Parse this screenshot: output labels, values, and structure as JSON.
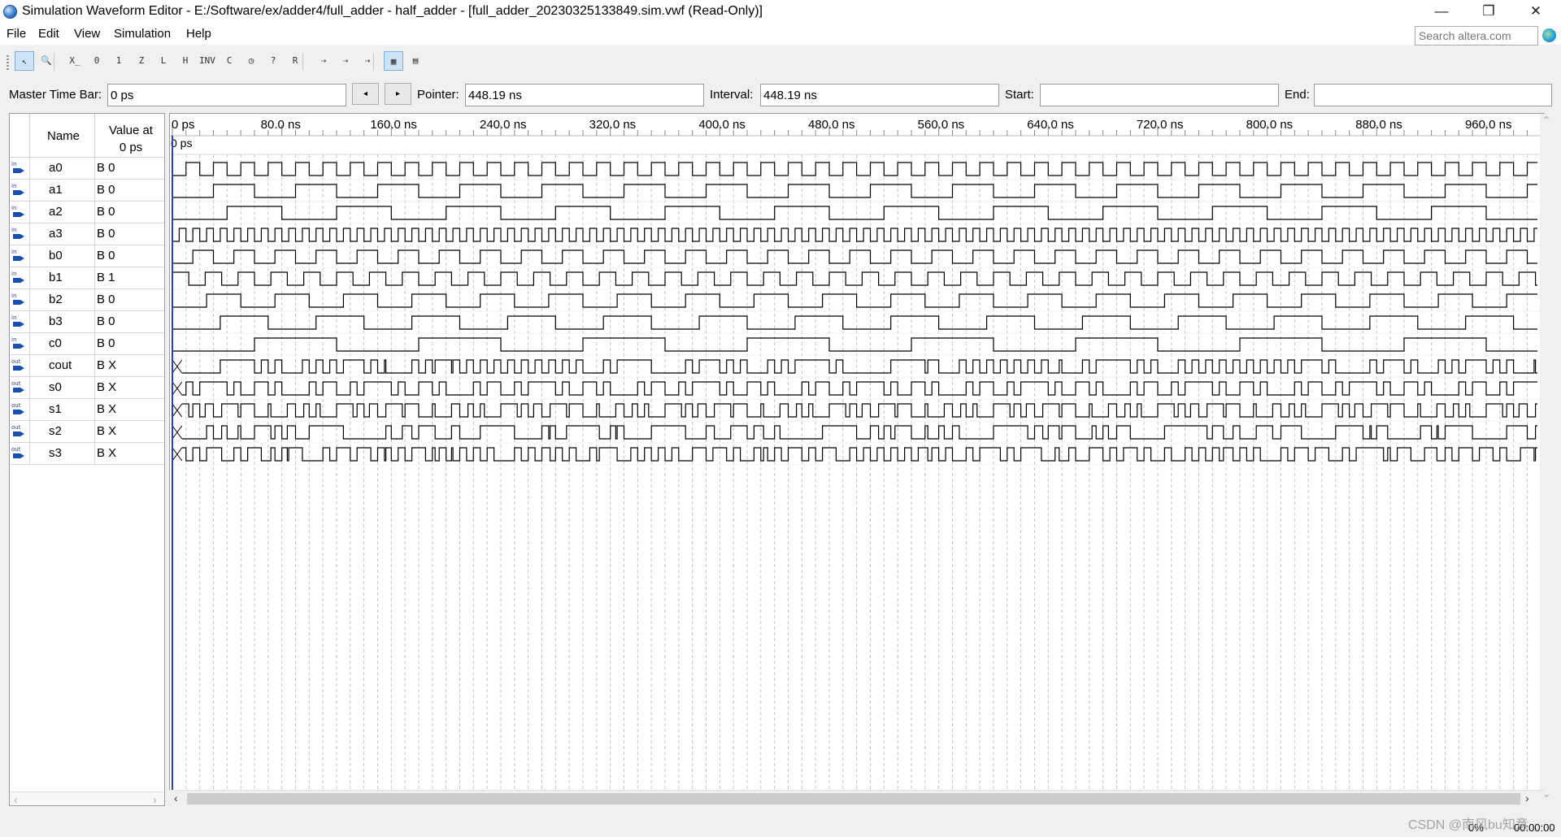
{
  "window": {
    "title": "Simulation Waveform Editor - E:/Software/ex/adder4/full_adder - half_adder - [full_adder_20230325133849.sim.vwf (Read-Only)]",
    "minimize": "—",
    "restore": "❐",
    "close": "✕"
  },
  "menu": {
    "items": [
      {
        "label": "File",
        "hotkey": "F"
      },
      {
        "label": "Edit",
        "hotkey": "E"
      },
      {
        "label": "View",
        "hotkey": "V"
      },
      {
        "label": "Simulation",
        "hotkey": "S"
      },
      {
        "label": "Help",
        "hotkey": "H"
      }
    ]
  },
  "search": {
    "placeholder": "Search altera.com"
  },
  "toolbar": {
    "buttons": [
      {
        "name": "selection-tool-icon",
        "glyph": "↖",
        "active": true
      },
      {
        "name": "zoom-tool-icon",
        "glyph": "🔍"
      },
      {
        "name": "force-unknown-icon",
        "glyph": "X̲"
      },
      {
        "name": "force-low-icon",
        "glyph": "0"
      },
      {
        "name": "force-high-icon",
        "glyph": "1"
      },
      {
        "name": "force-high-impedance-icon",
        "glyph": "Z"
      },
      {
        "name": "force-weak-low-icon",
        "glyph": "L"
      },
      {
        "name": "force-weak-high-icon",
        "glyph": "H"
      },
      {
        "name": "invert-icon",
        "glyph": "INV"
      },
      {
        "name": "count-value-icon",
        "glyph": "C"
      },
      {
        "name": "overwrite-clock-icon",
        "glyph": "◷"
      },
      {
        "name": "arbitrary-value-icon",
        "glyph": "?"
      },
      {
        "name": "random-values-icon",
        "glyph": "R"
      },
      {
        "name": "run-functional-icon",
        "glyph": "⇢"
      },
      {
        "name": "run-timing-icon",
        "glyph": "⇢"
      },
      {
        "name": "generate-netlist-icon",
        "glyph": "⇢"
      },
      {
        "name": "snap-to-grid-icon",
        "glyph": "▦",
        "active": true
      },
      {
        "name": "sort-icon",
        "glyph": "▤"
      }
    ]
  },
  "timebar": {
    "master_label": "Master Time Bar:",
    "master_value": "0 ps",
    "prev": "◂",
    "next": "▸",
    "pointer_label": "Pointer:",
    "pointer_value": "448.19 ns",
    "interval_label": "Interval:",
    "interval_value": "448.19 ns",
    "start_label": "Start:",
    "start_value": "",
    "end_label": "End:",
    "end_value": ""
  },
  "names_pane": {
    "col_name": "Name",
    "col_value_line1": "Value at",
    "col_value_line2": "0 ps"
  },
  "ruler": {
    "ticks": [
      "0 ps",
      "80.0 ns",
      "160.0 ns",
      "240.0 ns",
      "320.0 ns",
      "400.0 ns",
      "480.0 ns",
      "560.0 ns",
      "640.0 ns",
      "720.0 ns",
      "800.0 ns",
      "880.0 ns",
      "960.0 ns"
    ],
    "marker": "0 ps"
  },
  "signals": [
    {
      "name": "a0",
      "dir": "in",
      "value": "B 0",
      "half_period_ns": 10,
      "init": 0,
      "unknown_ns": 0
    },
    {
      "name": "a1",
      "dir": "in",
      "value": "B 0",
      "half_period_ns": 30,
      "init": 0,
      "unknown_ns": 0
    },
    {
      "name": "a2",
      "dir": "in",
      "value": "B 0",
      "half_period_ns": 40,
      "init": 0,
      "unknown_ns": 0
    },
    {
      "name": "a3",
      "dir": "in",
      "value": "B 0",
      "half_period_ns": 5,
      "init": 0,
      "unknown_ns": 0
    },
    {
      "name": "b0",
      "dir": "in",
      "value": "B 0",
      "half_period_ns": 15,
      "init": 0,
      "unknown_ns": 0
    },
    {
      "name": "b1",
      "dir": "in",
      "value": "B 1",
      "half_period_ns": 12,
      "init": 1,
      "unknown_ns": 0
    },
    {
      "name": "b2",
      "dir": "in",
      "value": "B 0",
      "half_period_ns": 25,
      "init": 0,
      "unknown_ns": 0
    },
    {
      "name": "b3",
      "dir": "in",
      "value": "B 0",
      "half_period_ns": 35,
      "init": 0,
      "unknown_ns": 0
    },
    {
      "name": "c0",
      "dir": "in",
      "value": "B 0",
      "half_period_ns": 60,
      "init": 0,
      "unknown_ns": 0
    },
    {
      "name": "cout",
      "dir": "out",
      "value": "B X",
      "half_period_ns": 0,
      "init": 0,
      "unknown_ns": 7
    },
    {
      "name": "s0",
      "dir": "out",
      "value": "B X",
      "half_period_ns": 0,
      "init": 0,
      "unknown_ns": 7
    },
    {
      "name": "s1",
      "dir": "out",
      "value": "B X",
      "half_period_ns": 0,
      "init": 0,
      "unknown_ns": 7
    },
    {
      "name": "s2",
      "dir": "out",
      "value": "B X",
      "half_period_ns": 0,
      "init": 0,
      "unknown_ns": 7
    },
    {
      "name": "s3",
      "dir": "out",
      "value": "B X",
      "half_period_ns": 0,
      "init": 0,
      "unknown_ns": 7
    }
  ],
  "status": {
    "progress": "0%",
    "elapsed": "00:00:00"
  },
  "watermark": "CSDN @南风bu知意"
}
